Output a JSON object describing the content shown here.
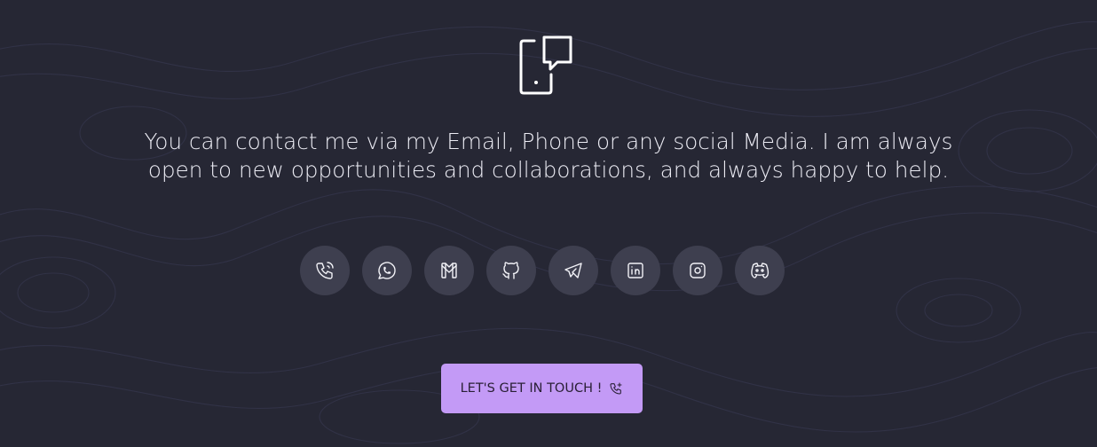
{
  "intro": {
    "line1": "You can contact me via my Email, Phone or any social Media. I am always",
    "line2": "open to new opportunities and collaborations, and always happy to help."
  },
  "socials": [
    {
      "icon": "phone-icon"
    },
    {
      "icon": "whatsapp-icon"
    },
    {
      "icon": "gmail-icon"
    },
    {
      "icon": "github-icon"
    },
    {
      "icon": "telegram-icon"
    },
    {
      "icon": "linkedin-icon"
    },
    {
      "icon": "instagram-icon"
    },
    {
      "icon": "discord-icon"
    }
  ],
  "cta": {
    "label": "LET'S GET IN TOUCH !"
  },
  "colors": {
    "background": "#262734",
    "icon_button": "#3e3f4f",
    "accent": "#c39af6",
    "text": "#ececf4"
  }
}
